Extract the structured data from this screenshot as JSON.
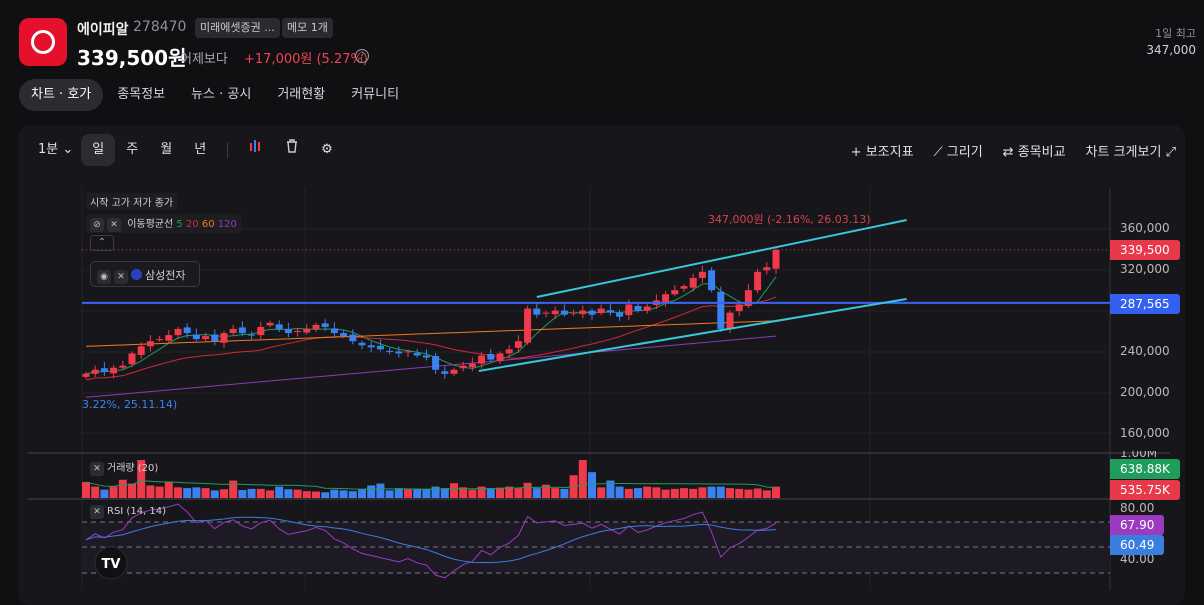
{
  "header": {
    "name": "에이피알",
    "code": "278470",
    "broker_chip": "미래에셋증권 ...",
    "memo_chip": "메모 1개",
    "price": "339,500원",
    "vs_label": "어제보다",
    "change": "+17,000원 (5.27%)",
    "help": "?",
    "day_high_label": "1일 최고",
    "day_high": "347,000"
  },
  "tabs": [
    {
      "label": "차트 · 호가",
      "active": true
    },
    {
      "label": "종목정보"
    },
    {
      "label": "뉴스 · 공시"
    },
    {
      "label": "거래현황"
    },
    {
      "label": "커뮤니티"
    }
  ],
  "toolbar": {
    "interval": "1분",
    "periods": [
      "일",
      "주",
      "월",
      "년"
    ],
    "indicators": "보조지표",
    "draw": "그리기",
    "compare": "종목비교",
    "expand": "차트 크게보기"
  },
  "legend": {
    "ohlc": "시작 고가 저가 종가",
    "ma_label": "이동평균선",
    "ma_periods": [
      "5",
      "20",
      "60",
      "120"
    ],
    "compare_name": "삼성전자",
    "volume": "거래량 (20)",
    "rsi": "RSI (14, 14)"
  },
  "colors": {
    "up": "#f0394b",
    "down": "#3b82f0",
    "ma5": "#1f9d5a",
    "ma20": "#d0283a",
    "ma60": "#f07a1f",
    "ma120": "#8e3bb5",
    "channel": "#38c6d9",
    "hline": "#3d63f5"
  },
  "annotations": {
    "high": "347,000원 (-2.16%, 26.03.13)",
    "low": "3.22%, 25.11.14)"
  },
  "axis": {
    "price_ticks": [
      "360,000",
      "320,000",
      "240,000",
      "200,000",
      "160,000"
    ],
    "volume_top": "1.00M",
    "rsi_ticks": [
      "80.00",
      "40.00"
    ]
  },
  "tags": {
    "last": "339,500",
    "hline": "287,565",
    "vol_ma": "638.88K",
    "vol": "535.75K",
    "rsi": "67.90",
    "rsi_signal": "60.49"
  },
  "chart_data": {
    "type": "candlestick",
    "closes": [
      218,
      222,
      220,
      224,
      226,
      238,
      245,
      250,
      252,
      256,
      262,
      258,
      252,
      255,
      250,
      258,
      262,
      258,
      256,
      264,
      268,
      262,
      258,
      260,
      262,
      266,
      264,
      258,
      255,
      250,
      246,
      244,
      242,
      240,
      238,
      240,
      236,
      234,
      222,
      218,
      222,
      226,
      228,
      236,
      232,
      238,
      242,
      250,
      282,
      276,
      278,
      280,
      276,
      278,
      280,
      276,
      282,
      278,
      274,
      286,
      280,
      284,
      290,
      296,
      300,
      304,
      312,
      318,
      300,
      262,
      278,
      286,
      300,
      318,
      322.5,
      339.5
    ],
    "volumes_k": [
      420,
      300,
      220,
      300,
      480,
      380,
      1100,
      330,
      300,
      420,
      280,
      260,
      280,
      260,
      200,
      230,
      460,
      210,
      240,
      240,
      200,
      300,
      230,
      220,
      180,
      170,
      150,
      220,
      200,
      180,
      230,
      330,
      380,
      200,
      260,
      230,
      250,
      230,
      300,
      260,
      390,
      280,
      220,
      300,
      240,
      270,
      300,
      260,
      400,
      260,
      350,
      260,
      240,
      600,
      1300,
      680,
      280,
      460,
      300,
      240,
      260,
      300,
      280,
      220,
      240,
      260,
      240,
      280,
      300,
      300,
      260,
      240,
      220,
      250,
      200,
      300
    ],
    "ma60": [
      245,
      270
    ],
    "ma120": [
      195,
      255
    ],
    "channel_top": [
      [
        49,
        293.3
      ],
      [
        89.2,
        368.8
      ]
    ],
    "channel_bottom": [
      [
        42.7,
        220.8
      ],
      [
        89.2,
        291.4
      ]
    ],
    "hline": 287.565,
    "yrange": [
      160,
      360
    ],
    "unit": "thousand KRW"
  }
}
